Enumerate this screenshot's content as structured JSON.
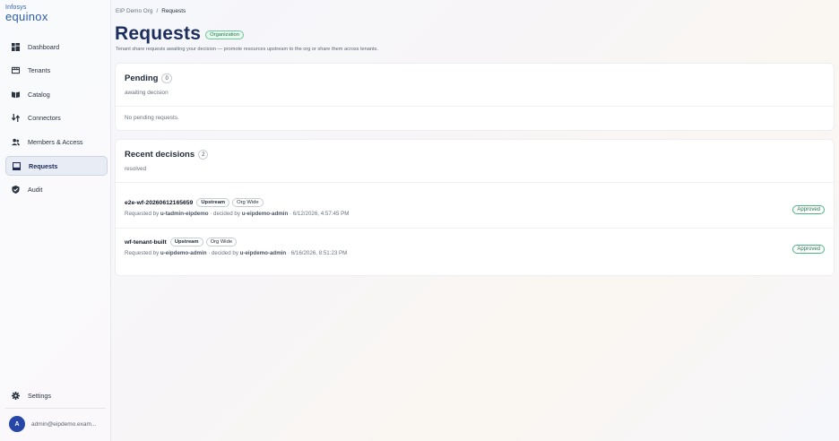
{
  "brand": {
    "line1": "Infosys",
    "line2": "equinox"
  },
  "sidebar": {
    "items": [
      {
        "label": "Dashboard",
        "icon": "dashboard-icon"
      },
      {
        "label": "Tenants",
        "icon": "tenants-icon"
      },
      {
        "label": "Catalog",
        "icon": "catalog-icon"
      },
      {
        "label": "Connectors",
        "icon": "connectors-icon"
      },
      {
        "label": "Members & Access",
        "icon": "members-icon"
      },
      {
        "label": "Requests",
        "icon": "requests-icon",
        "active": true
      },
      {
        "label": "Audit",
        "icon": "audit-icon"
      }
    ],
    "settings_label": "Settings",
    "user": {
      "initial": "A",
      "email": "admin@eipdemo.exam..."
    }
  },
  "breadcrumb": {
    "org": "EIP Demo Org",
    "separator": "/",
    "current": "Requests"
  },
  "header": {
    "title": "Requests",
    "badge": "Organization",
    "subtitle": "Tenant share requests awaiting your decision — promote resources upstream to the org or share them across tenants."
  },
  "pending": {
    "title": "Pending",
    "count": "0",
    "subtitle": "awaiting decision",
    "empty": "No pending requests."
  },
  "recent": {
    "title": "Recent decisions",
    "count": "2",
    "subtitle": "resolved",
    "rows": [
      {
        "name": "e2e-wf-20260612165659",
        "tags": [
          "Upstream",
          "Org Wide"
        ],
        "requested_prefix": "Requested by ",
        "requested_by": "u-tadmin-eipdemo",
        "decided_prefix": " · decided by ",
        "decided_by": "u-eipdemo-admin",
        "timestamp": " · 6/12/2026, 4:57:45 PM",
        "status": "Approved"
      },
      {
        "name": "wf-tenant-built",
        "tags": [
          "Upstream",
          "Org Wide"
        ],
        "requested_prefix": "Requested by ",
        "requested_by": "u-eipdemo-admin",
        "decided_prefix": " · decided by ",
        "decided_by": "u-eipdemo-admin",
        "timestamp": " · 6/16/2026, 8:51:23 PM",
        "status": "Approved"
      }
    ]
  },
  "colors": {
    "brand": "#2d5fa6",
    "title": "#1c2d5e",
    "success": "#1d7a4e",
    "avatar": "#2647a8"
  }
}
